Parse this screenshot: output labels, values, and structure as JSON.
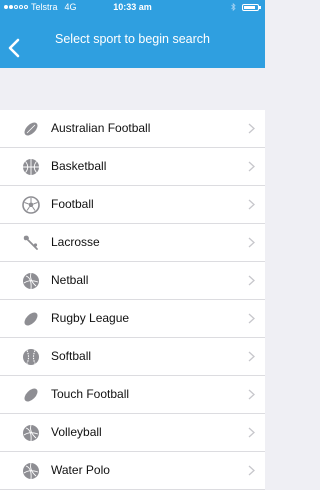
{
  "status_bar": {
    "carrier": "Telstra",
    "network": "4G",
    "time": "10:33 am"
  },
  "header": {
    "title": "Select sport to begin search"
  },
  "sports": [
    {
      "label": "Australian Football",
      "icon": "australian-football-icon"
    },
    {
      "label": "Basketball",
      "icon": "basketball-icon"
    },
    {
      "label": "Football",
      "icon": "soccer-ball-icon"
    },
    {
      "label": "Lacrosse",
      "icon": "lacrosse-stick-icon"
    },
    {
      "label": "Netball",
      "icon": "netball-icon"
    },
    {
      "label": "Rugby League",
      "icon": "rugby-ball-icon"
    },
    {
      "label": "Softball",
      "icon": "softball-icon"
    },
    {
      "label": "Touch Football",
      "icon": "touch-football-icon"
    },
    {
      "label": "Volleyball",
      "icon": "volleyball-icon"
    },
    {
      "label": "Water Polo",
      "icon": "water-polo-ball-icon"
    }
  ],
  "colors": {
    "header": "#2f9fe0",
    "background": "#efeff4",
    "icon": "#8e8e93",
    "chevron": "#c7c7cc"
  }
}
